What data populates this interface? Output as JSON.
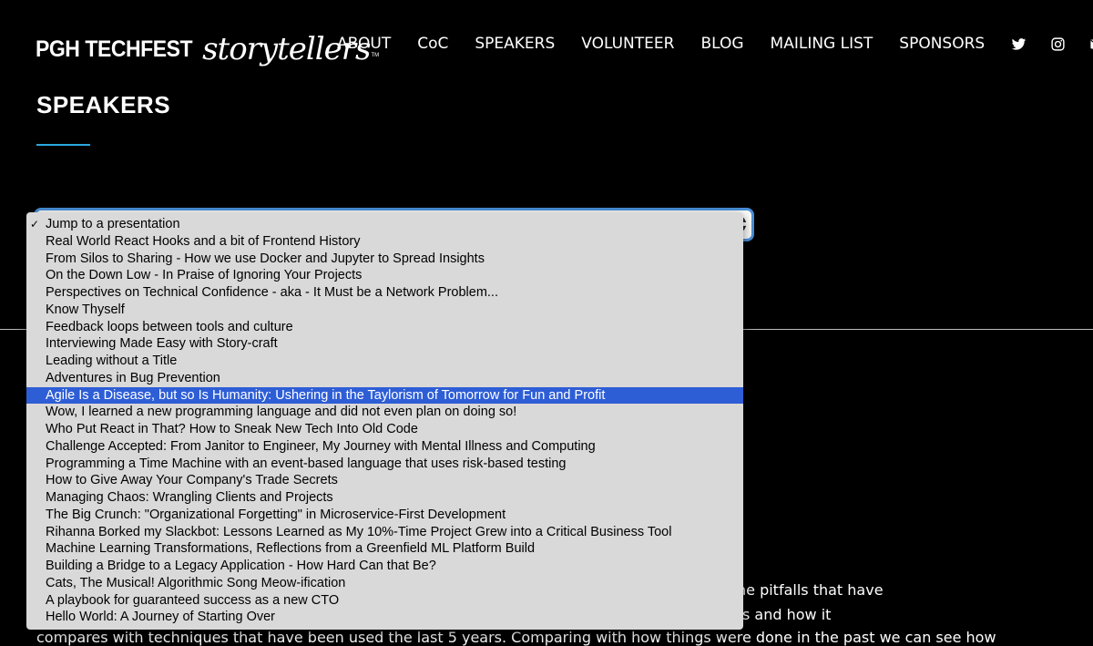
{
  "logo": {
    "main": "PGH TECHFEST",
    "script": "storytellers",
    "tm": "TM"
  },
  "nav": {
    "items": [
      "ABOUT",
      "CoC",
      "SPEAKERS",
      "VOLUNTEER",
      "BLOG",
      "MAILING LIST",
      "SPONSORS"
    ],
    "icons": [
      "twitter-icon",
      "instagram-icon",
      "envelope-icon"
    ]
  },
  "page": {
    "title": "SPEAKERS"
  },
  "background_text": {
    "line1_partial": "he pitfalls that have",
    "line2_partial": "s and how it",
    "line3": "compares with techniques that have been used the last 5 years. Comparing with how things were done in the past we can see how"
  },
  "select": {
    "selected_index": 0,
    "highlighted_index": 10,
    "options": [
      "Jump to a presentation",
      "Real World React Hooks and a bit of Frontend History",
      "From Silos to Sharing - How we use Docker and Jupyter to Spread Insights",
      "On the Down Low - In Praise of Ignoring Your Projects",
      "Perspectives on Technical Confidence - aka - It Must be a Network Problem...",
      "Know Thyself",
      "Feedback loops between tools and culture",
      "Interviewing Made Easy with Story-craft",
      "Leading without a Title",
      "Adventures in Bug Prevention",
      "Agile Is a Disease, but so Is Humanity: Ushering in the Taylorism of Tomorrow for Fun and Profit",
      "Wow, I learned a new programming language and did not even plan on doing so!",
      "Who Put React in That? How to Sneak New Tech Into Old Code",
      "Challenge Accepted: From Janitor to Engineer, My Journey with Mental Illness and Computing",
      "Programming a Time Machine with an event-based language that uses risk-based testing",
      "How to Give Away Your Company's Trade Secrets",
      "Managing Chaos: Wrangling Clients and Projects",
      "The Big Crunch: \"Organizational Forgetting\" in Microservice-First Development",
      "Rihanna Borked my Slackbot: Lessons Learned as My 10%-Time Project Grew into a Critical Business Tool",
      "Machine Learning Transformations, Reflections from a Greenfield ML Platform Build",
      "Building a Bridge to a Legacy Application - How Hard Can that Be?",
      "Cats, The Musical! Algorithmic Song Meow-ification",
      "A playbook for guaranteed success as a new CTO",
      "Hello World: A Journey of Starting Over"
    ]
  }
}
